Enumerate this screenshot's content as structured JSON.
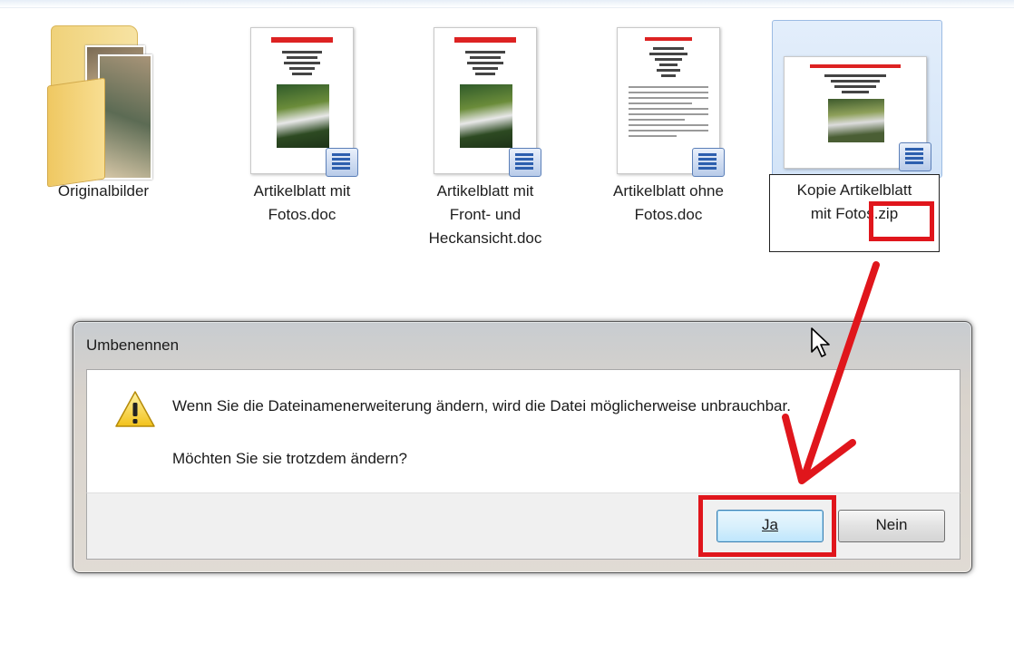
{
  "files": [
    {
      "label": "Originalbilder",
      "type": "folder"
    },
    {
      "label": "Artikelblatt mit\nFotos.doc",
      "type": "doc"
    },
    {
      "label": "Artikelblatt mit\nFront- und\nHeckansicht.doc",
      "type": "doc"
    },
    {
      "label": "Artikelblatt ohne\nFotos.doc",
      "type": "doc"
    },
    {
      "label": "Kopie Artikelblatt\nmit Fotos.zip",
      "type": "doc",
      "state": "renaming"
    }
  ],
  "dialog": {
    "title": "Umbenennen",
    "message": "Wenn Sie die Dateinamenerweiterung ändern, wird die Datei möglicherweise unbrauchbar.",
    "question": "Möchten Sie sie trotzdem ändern?",
    "yes_label": "Ja",
    "no_label": "Nein"
  },
  "colors": {
    "highlight": "#e0161c",
    "selection": "#d3e4f8"
  }
}
